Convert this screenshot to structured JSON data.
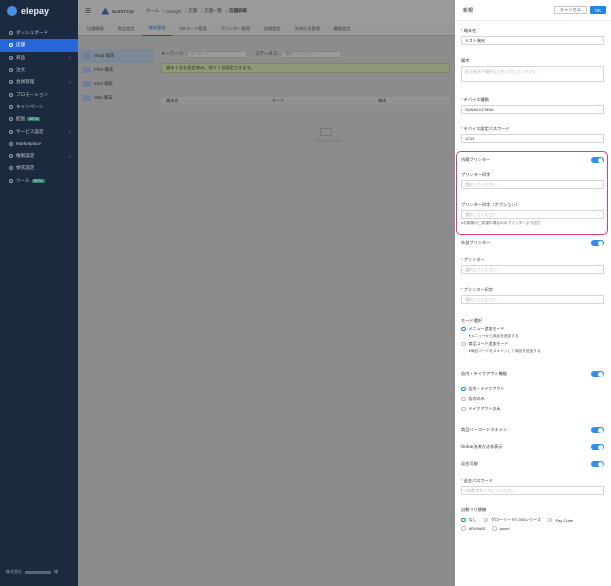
{
  "sidebar": {
    "brand": "elepay",
    "items": [
      {
        "label": "ダッシュボード",
        "active": false,
        "chevron": false
      },
      {
        "label": "店舗",
        "active": true,
        "chevron": false
      },
      {
        "label": "商品",
        "active": false,
        "chevron": true
      },
      {
        "label": "注文",
        "active": false,
        "chevron": false
      },
      {
        "label": "会員管理",
        "active": false,
        "chevron": true
      },
      {
        "label": "プロモーション",
        "active": false,
        "chevron": false
      },
      {
        "label": "キャンペーン",
        "active": false,
        "chevron": false
      },
      {
        "label": "配送",
        "active": false,
        "chevron": false,
        "badge": "BETA"
      },
      {
        "label": "サービス設定",
        "active": false,
        "chevron": true
      },
      {
        "label": "Marketplace",
        "active": false,
        "chevron": false
      },
      {
        "label": "権限設定",
        "active": false,
        "chevron": true
      },
      {
        "label": "委託設定",
        "active": false,
        "chevron": false
      },
      {
        "label": "ツール",
        "active": false,
        "chevron": false,
        "badge": "BETA"
      }
    ],
    "footer_label": "株式会社",
    "footer_suffix": "様"
  },
  "topbar": {
    "company": "ELESTYLE",
    "breadcrumbs": [
      "ホーム",
      "OneQR",
      "店舗",
      "店舗一覧",
      "店舗詳細"
    ]
  },
  "tabs": [
    "店舗情報",
    "商品設定",
    "端末管理",
    "QRコード管理",
    "プリンター管理",
    "詳細設定",
    "決済方法管理",
    "機能設定"
  ],
  "subnav": [
    "Shop 端末",
    "POS 端末",
    "KDS 端末",
    "Wait 端末"
  ],
  "filters": {
    "keyword_label": "キーワード:",
    "keyword_placeholder": "キーワード",
    "status_label": "ステータス:",
    "status_placeholder": "選択してください"
  },
  "notice": "端末 1 台を設定済み。残り 1 台設定できます。",
  "table_headers": [
    "端末名",
    "モード",
    "端末"
  ],
  "empty_text": "データがありません",
  "drawer": {
    "title": "新規",
    "cancel": "キャンセル",
    "ok": "OK",
    "terminal_name_label": "端末名",
    "terminal_name_value": "テスト端末",
    "memo_label": "備考",
    "memo_placeholder": "担当者名や場所などを入力してください",
    "device_type_label": "デバイス種類",
    "device_type_value": "SUNMI K2 MINI",
    "device_password_label": "デバイス設定パスワード",
    "device_password_value": "1234",
    "builtin_printer_label": "内蔵プリンター",
    "printer_print_label": "プリンター印字",
    "printer_print_placeholder": "選択してください",
    "printer_print_optional_label": "プリンター印字（オプション）",
    "printer_print_optional_placeholder": "選択してください",
    "printer_hint": "●お客様がご希望の場合のみプリンターより出力",
    "external_printer_label": "外部プリンター",
    "printer_label": "プリンター",
    "printer_placeholder": "選択してください",
    "printer_print2_label": "プリンター印字",
    "printer_print2_placeholder": "選択してください",
    "mode_label": "モード選択",
    "mode_options": [
      {
        "label": "メニュー追加モード",
        "hint": "●メニューから商品を追加する",
        "selected": true
      },
      {
        "label": "商品コード追加モード",
        "hint": "●商品コードをスキャンして商品を追加する",
        "selected": false
      }
    ],
    "takeout_label": "店内・テイクアウト機能",
    "takeout_options": [
      {
        "label": "店内・テイクアウト",
        "selected": true
      },
      {
        "label": "店内のみ",
        "selected": false
      },
      {
        "label": "テイクアウトのみ",
        "selected": false
      }
    ],
    "barcode_label": "商品バーコードスキャン",
    "online_payment_label": "Online決済方法非表示",
    "refund_label": "返金可能",
    "refund_password_label": "返金パスワード",
    "refund_password_placeholder": "4桁数字を入力してください",
    "change_machine_label": "自動つり銭機",
    "change_machine_options": [
      {
        "label": "なし",
        "selected": true
      },
      {
        "label": "グローリー RT-300シリーズ",
        "selected": false
      },
      {
        "label": "Pay Cube",
        "selected": false
      },
      {
        "label": "ARUNAS",
        "selected": false
      },
      {
        "label": "laurel",
        "selected": false
      }
    ]
  }
}
